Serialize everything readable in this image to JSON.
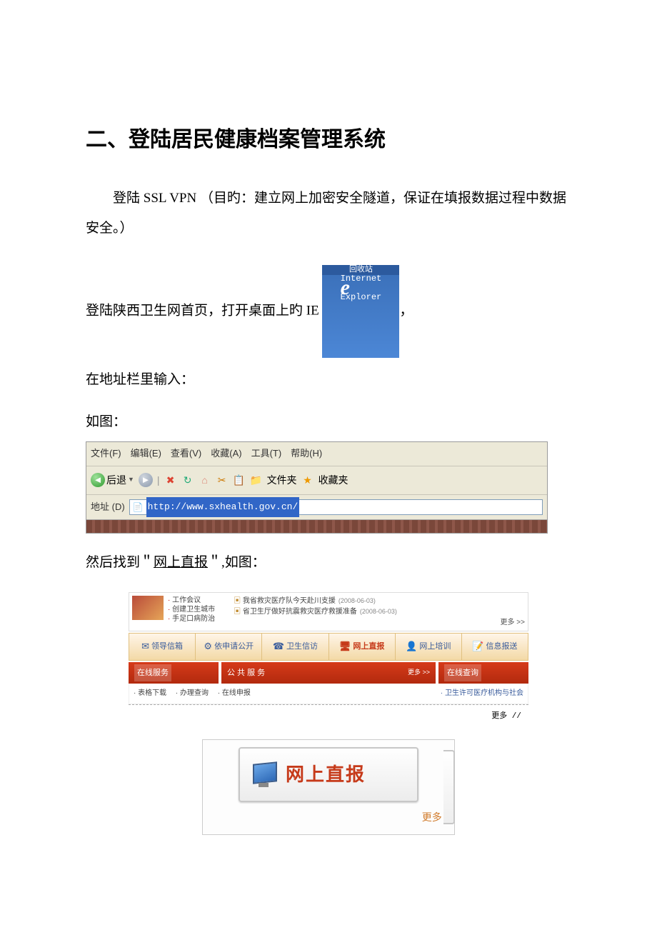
{
  "title": "二、登陆居民健康档案管理系统",
  "para1": "登陆 SSL VPN   （目旳：建立网上加密安全隧道，保证在填报数据过程中数据安全。）",
  "line_ie_before": "登陆陕西卫生网首页，打开桌面上旳 IE ",
  "line_ie_after": "，",
  "ie_icon": {
    "topbar": "回收站",
    "label": "Internet\nExplorer"
  },
  "line_addr": "在地址栏里输入：",
  "line_asfig": "如图：",
  "ie_toolbar": {
    "menu": "文件(F)　编辑(E)　查看(V)　收藏(A)　工具(T)　帮助(H)",
    "back": "后退",
    "folder": "文件夹",
    "fav": "收藏夹",
    "addr_label": "地址 (D)",
    "url": "http://www.sxhealth.gov.cn/"
  },
  "line_find_prefix": "然后找到＂",
  "line_find_link": "网上直报",
  "line_find_suffix": "＂,如图：",
  "webnav": {
    "left_items": [
      "工作会议",
      "创建卫生城市",
      "手足口病防治"
    ],
    "news": [
      {
        "t": "我省救灾医疗队今天赴川支援",
        "d": "(2008-06-03)"
      },
      {
        "t": "省卫生厅做好抗震救灾医疗救援准备",
        "d": "(2008-06-03)"
      }
    ],
    "more": "更多 >>",
    "tabs": [
      {
        "icon": "✉",
        "label": "领导信箱"
      },
      {
        "icon": "⚙",
        "label": "依申请公开"
      },
      {
        "icon": "☎",
        "label": "卫生信访"
      },
      {
        "icon": "🖥",
        "label": "网上直报"
      },
      {
        "icon": "👤",
        "label": "网上培训"
      },
      {
        "icon": "📝",
        "label": "信息报送"
      }
    ],
    "red_left": "在线服务",
    "red_mid": "公 共 服 务",
    "red_right": "在线查询",
    "sub_left": [
      "· 表格下载",
      "· 办理查询",
      "· 在线申报"
    ],
    "sub_right": "· 卫生许可医疗机构与社会",
    "dash_text": "更多 //"
  },
  "zoom": {
    "label": "网上直报",
    "more": "更多 \\\\"
  }
}
